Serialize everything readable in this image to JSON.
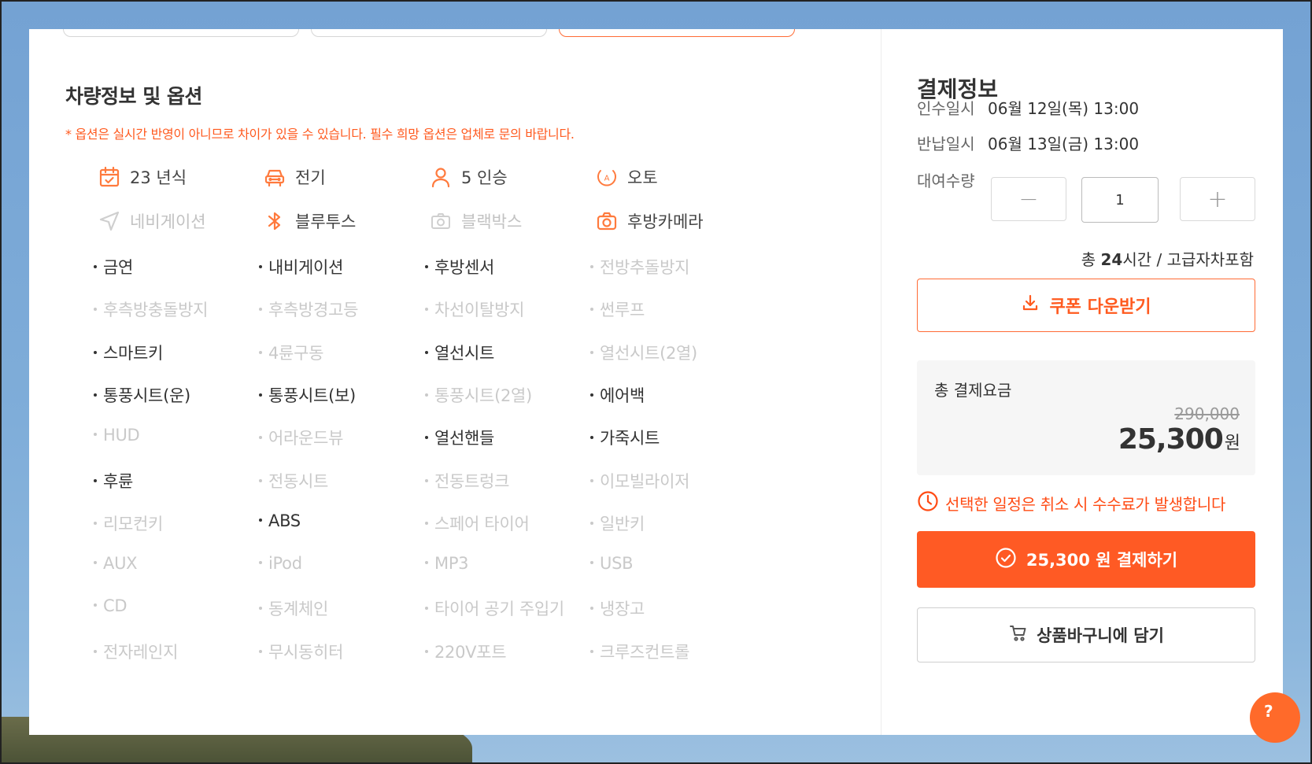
{
  "vehicle": {
    "section_title": "차량정보 및 옵션",
    "notice": "* 옵션은 실시간 반영이 아니므로 차이가 있을 수 있습니다. 필수 희망 옵션은 업체로 문의 바랍니다.",
    "specs": [
      {
        "label": "23 년식",
        "icon": "calendar-icon",
        "active": true
      },
      {
        "label": "전기",
        "icon": "car-front-icon",
        "active": true
      },
      {
        "label": "5 인승",
        "icon": "person-icon",
        "active": true
      },
      {
        "label": "오토",
        "icon": "auto-transmission-icon",
        "active": true
      },
      {
        "label": "네비게이션",
        "icon": "navigation-icon",
        "active": false
      },
      {
        "label": "블루투스",
        "icon": "bluetooth-icon",
        "active": true
      },
      {
        "label": "블랙박스",
        "icon": "dashcam-icon",
        "active": false
      },
      {
        "label": "후방카메라",
        "icon": "rear-camera-icon",
        "active": true
      }
    ],
    "options": [
      {
        "label": "금연",
        "active": true
      },
      {
        "label": "내비게이션",
        "active": true
      },
      {
        "label": "후방센서",
        "active": true
      },
      {
        "label": "전방추돌방지",
        "active": false
      },
      {
        "label": "후측방충돌방지",
        "active": false
      },
      {
        "label": "후측방경고등",
        "active": false
      },
      {
        "label": "차선이탈방지",
        "active": false
      },
      {
        "label": "썬루프",
        "active": false
      },
      {
        "label": "스마트키",
        "active": true
      },
      {
        "label": "4륜구동",
        "active": false
      },
      {
        "label": "열선시트",
        "active": true
      },
      {
        "label": "열선시트(2열)",
        "active": false
      },
      {
        "label": "통풍시트(운)",
        "active": true
      },
      {
        "label": "통풍시트(보)",
        "active": true
      },
      {
        "label": "통풍시트(2열)",
        "active": false
      },
      {
        "label": "에어백",
        "active": true
      },
      {
        "label": "HUD",
        "active": false
      },
      {
        "label": "어라운드뷰",
        "active": false
      },
      {
        "label": "열선핸들",
        "active": true
      },
      {
        "label": "가죽시트",
        "active": true
      },
      {
        "label": "후륜",
        "active": true
      },
      {
        "label": "전동시트",
        "active": false
      },
      {
        "label": "전동트렁크",
        "active": false
      },
      {
        "label": "이모빌라이저",
        "active": false
      },
      {
        "label": "리모컨키",
        "active": false
      },
      {
        "label": "ABS",
        "active": true
      },
      {
        "label": "스페어 타이어",
        "active": false
      },
      {
        "label": "일반키",
        "active": false
      },
      {
        "label": "AUX",
        "active": false
      },
      {
        "label": "iPod",
        "active": false
      },
      {
        "label": "MP3",
        "active": false
      },
      {
        "label": "USB",
        "active": false
      },
      {
        "label": "CD",
        "active": false
      },
      {
        "label": "동계체인",
        "active": false
      },
      {
        "label": "타이어 공기 주입기",
        "active": false
      },
      {
        "label": "냉장고",
        "active": false
      },
      {
        "label": "전자레인지",
        "active": false
      },
      {
        "label": "무시동히터",
        "active": false
      },
      {
        "label": "220V포트",
        "active": false
      },
      {
        "label": "크루즈컨트롤",
        "active": false
      }
    ]
  },
  "payment": {
    "title": "결제정보",
    "pickup_label": "인수일시",
    "pickup_value": "06월 12일(목) 13:00",
    "return_label": "반납일시",
    "return_value": "06월 13일(금) 13:00",
    "quantity_label": "대여수량",
    "quantity_minus": "−",
    "quantity_value": "1",
    "quantity_plus": "+",
    "total_prefix": "총 ",
    "total_hours": "24",
    "total_suffix": "시간 / 고급자차포함",
    "coupon_label": "쿠폰 다운받기",
    "total_price_label": "총 결제요금",
    "original_price": "290,000",
    "final_price": "25,300",
    "currency_unit": "원",
    "cancel_notice": "선택한 일정은 취소 시 수수료가 발생합니다",
    "pay_button_label": "25,300 원 결제하기",
    "cart_button_label": "상품바구니에 담기",
    "help_label": "?"
  },
  "colors": {
    "accent": "#ff5a24",
    "accent_text": "#ff5a1f",
    "spec_icon": "#ff7a3d",
    "inactive": "#c9c9c9"
  }
}
